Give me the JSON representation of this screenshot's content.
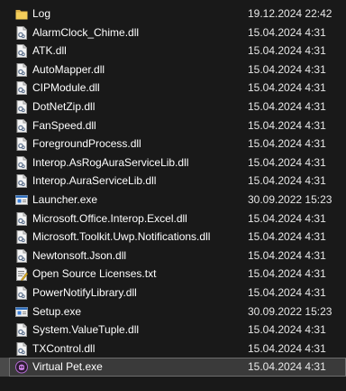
{
  "files": [
    {
      "name": "Log",
      "modified": "19.12.2024 22:42",
      "icon": "folder-icon"
    },
    {
      "name": "AlarmClock_Chime.dll",
      "modified": "15.04.2024 4:31",
      "icon": "dll-file-icon"
    },
    {
      "name": "ATK.dll",
      "modified": "15.04.2024 4:31",
      "icon": "dll-file-icon"
    },
    {
      "name": "AutoMapper.dll",
      "modified": "15.04.2024 4:31",
      "icon": "dll-file-icon"
    },
    {
      "name": "CIPModule.dll",
      "modified": "15.04.2024 4:31",
      "icon": "dll-file-icon"
    },
    {
      "name": "DotNetZip.dll",
      "modified": "15.04.2024 4:31",
      "icon": "dll-file-icon"
    },
    {
      "name": "FanSpeed.dll",
      "modified": "15.04.2024 4:31",
      "icon": "dll-file-icon"
    },
    {
      "name": "ForegroundProcess.dll",
      "modified": "15.04.2024 4:31",
      "icon": "dll-file-icon"
    },
    {
      "name": "Interop.AsRogAuraServiceLib.dll",
      "modified": "15.04.2024 4:31",
      "icon": "dll-file-icon"
    },
    {
      "name": "Interop.AuraServiceLib.dll",
      "modified": "15.04.2024 4:31",
      "icon": "dll-file-icon"
    },
    {
      "name": "Launcher.exe",
      "modified": "30.09.2022 15:23",
      "icon": "exe-file-icon"
    },
    {
      "name": "Microsoft.Office.Interop.Excel.dll",
      "modified": "15.04.2024 4:31",
      "icon": "dll-file-icon"
    },
    {
      "name": "Microsoft.Toolkit.Uwp.Notifications.dll",
      "modified": "15.04.2024 4:31",
      "icon": "dll-file-icon"
    },
    {
      "name": "Newtonsoft.Json.dll",
      "modified": "15.04.2024 4:31",
      "icon": "dll-file-icon"
    },
    {
      "name": "Open Source Licenses.txt",
      "modified": "15.04.2024 4:31",
      "icon": "text-file-icon"
    },
    {
      "name": "PowerNotifyLibrary.dll",
      "modified": "15.04.2024 4:31",
      "icon": "dll-file-icon"
    },
    {
      "name": "Setup.exe",
      "modified": "30.09.2022 15:23",
      "icon": "exe-file-icon"
    },
    {
      "name": "System.ValueTuple.dll",
      "modified": "15.04.2024 4:31",
      "icon": "dll-file-icon"
    },
    {
      "name": "TXControl.dll",
      "modified": "15.04.2024 4:31",
      "icon": "dll-file-icon"
    },
    {
      "name": "Virtual Pet.exe",
      "modified": "15.04.2024 4:31",
      "icon": "virtual-pet-app-icon",
      "selected": true
    }
  ],
  "colors": {
    "background": "#191919",
    "text": "#ffffff",
    "selection": "#3a3a3a",
    "folder": "#f2c94c"
  }
}
